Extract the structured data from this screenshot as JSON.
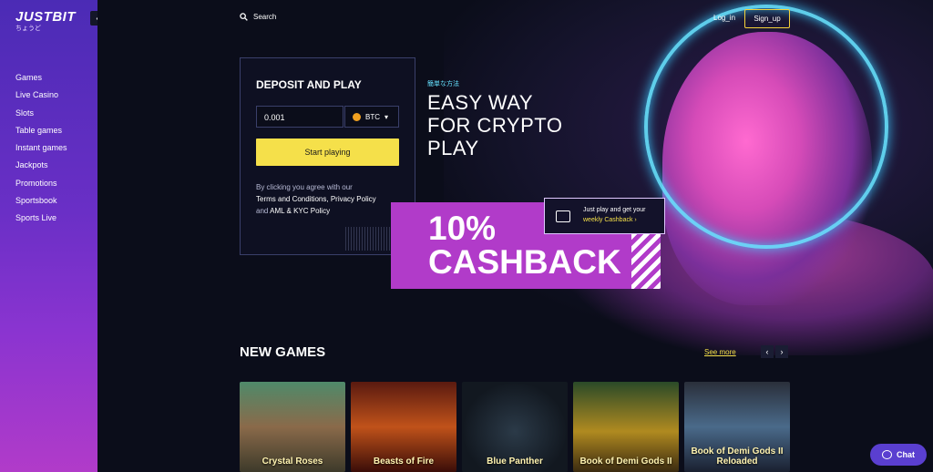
{
  "brand": {
    "name": "JUSTBIT",
    "subtitle": "ちょうど"
  },
  "sidebar": {
    "items": [
      {
        "label": "Games"
      },
      {
        "label": "Live Casino"
      },
      {
        "label": "Slots"
      },
      {
        "label": "Table games"
      },
      {
        "label": "Instant games"
      },
      {
        "label": "Jackpots"
      },
      {
        "label": "Promotions"
      },
      {
        "label": "Sportsbook"
      },
      {
        "label": "Sports Live"
      }
    ]
  },
  "header": {
    "search_label": "Search",
    "login_label": "Log_in",
    "signup_label": "Sign_up"
  },
  "deposit": {
    "title": "DEPOSIT AND PLAY",
    "amount_value": "0.001",
    "currency": "BTC",
    "button_label": "Start playing",
    "terms_prefix": "By clicking you agree with our",
    "terms_link": "Terms and Conditions,",
    "privacy_link": "Privacy Policy",
    "and_text": "and",
    "aml_link": "AML & KYC Policy"
  },
  "hero": {
    "japanese": "簡単な方法",
    "headline_1": "EASY WAY",
    "headline_2": "FOR CRYPTO",
    "headline_3": "PLAY",
    "cashback_1": "10%",
    "cashback_2": "CASHBACK",
    "promo_line1": "Just play and get your",
    "promo_line2": "weekly Cashback ›"
  },
  "new_games": {
    "title": "NEW GAMES",
    "see_more": "See more",
    "prev": "‹",
    "next": "›",
    "games": [
      {
        "title": "Crystal Roses"
      },
      {
        "title": "Beasts of Fire"
      },
      {
        "title": "Blue Panther"
      },
      {
        "title": "Book of Demi Gods II"
      },
      {
        "title": "Book of Demi Gods II Reloaded"
      }
    ]
  },
  "chat": {
    "label": "Chat"
  },
  "colors": {
    "accent_yellow": "#f5e04a",
    "accent_purple": "#b13bc9",
    "neon_cyan": "#66e2ff",
    "sidebar_top": "#4b2bb5"
  }
}
